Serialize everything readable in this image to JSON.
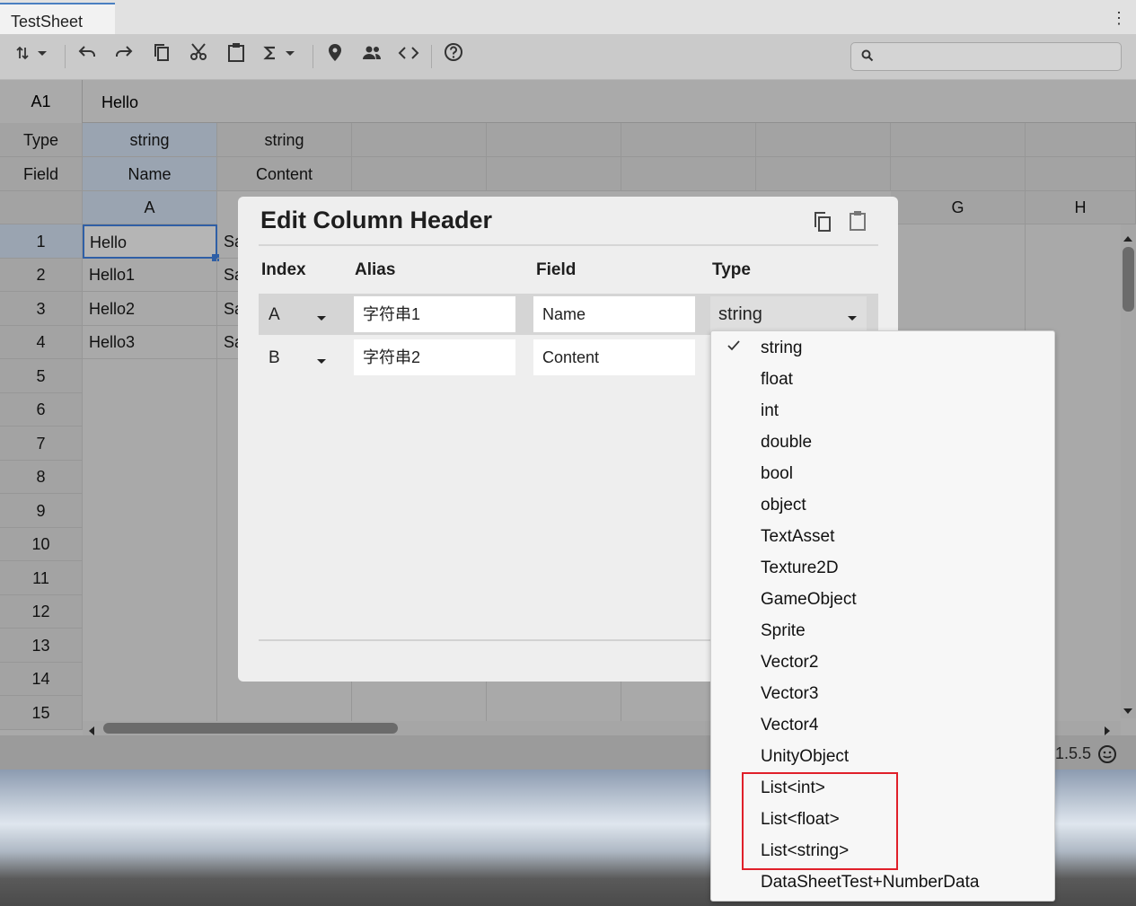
{
  "window": {
    "tab_title": "TestSheet",
    "kebab": "⋮"
  },
  "toolbar": {
    "icons": [
      "sort-icon",
      "undo-icon",
      "redo-icon",
      "copy-icon",
      "cut-icon",
      "paste-icon",
      "sum-icon",
      "pin-icon",
      "users-icon",
      "code-icon",
      "help-icon"
    ],
    "search_placeholder": ""
  },
  "formula": {
    "cell_ref": "A1",
    "value": "Hello"
  },
  "sheet": {
    "type_label": "Type",
    "field_label": "Field",
    "type_row": [
      "string",
      "string"
    ],
    "field_row": [
      "Name",
      "Content"
    ],
    "col_letters": [
      "A",
      "G",
      "H"
    ],
    "row_numbers": [
      "1",
      "2",
      "3",
      "4",
      "5",
      "6",
      "7",
      "8",
      "9",
      "10",
      "11",
      "12",
      "13",
      "14",
      "15"
    ],
    "col_a": [
      "Hello",
      "Hello1",
      "Hello2",
      "Hello3"
    ],
    "col_b_partial": [
      "Sa",
      "Sa",
      "Sa",
      "Sa"
    ]
  },
  "status": {
    "version": "1.5.5"
  },
  "dialog": {
    "title": "Edit Column Header",
    "headers": {
      "index": "Index",
      "alias": "Alias",
      "field": "Field",
      "type": "Type"
    },
    "rows": [
      {
        "index": "A",
        "alias": "字符串1",
        "field": "Name",
        "type": "string"
      },
      {
        "index": "B",
        "alias": "字符串2",
        "field": "Content"
      }
    ]
  },
  "type_menu": {
    "selected": "string",
    "options": [
      "string",
      "float",
      "int",
      "double",
      "bool",
      "object",
      "TextAsset",
      "Texture2D",
      "GameObject",
      "Sprite",
      "Vector2",
      "Vector3",
      "Vector4",
      "UnityObject",
      "List<int>",
      "List<float>",
      "List<string>",
      "DataSheetTest+NumberData"
    ],
    "highlight_color": "#e0202a"
  }
}
